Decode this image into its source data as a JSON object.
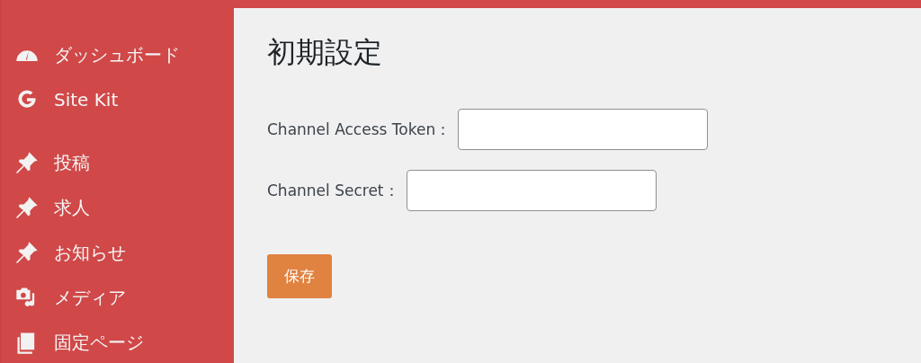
{
  "sidebar": {
    "groups": [
      {
        "items": [
          {
            "label": "ダッシュボード",
            "kind": "dashboard"
          },
          {
            "label": "Site Kit",
            "kind": "google"
          }
        ]
      },
      {
        "items": [
          {
            "label": "投稿",
            "kind": "pin"
          },
          {
            "label": "求人",
            "kind": "pin"
          },
          {
            "label": "お知らせ",
            "kind": "pin"
          },
          {
            "label": "メディア",
            "kind": "media"
          },
          {
            "label": "固定ページ",
            "kind": "page"
          }
        ]
      }
    ]
  },
  "page": {
    "title": "初期設定",
    "fields": [
      {
        "label": "Channel Access Token："
      },
      {
        "label": "Channel Secret："
      }
    ],
    "save_button": "保存"
  }
}
